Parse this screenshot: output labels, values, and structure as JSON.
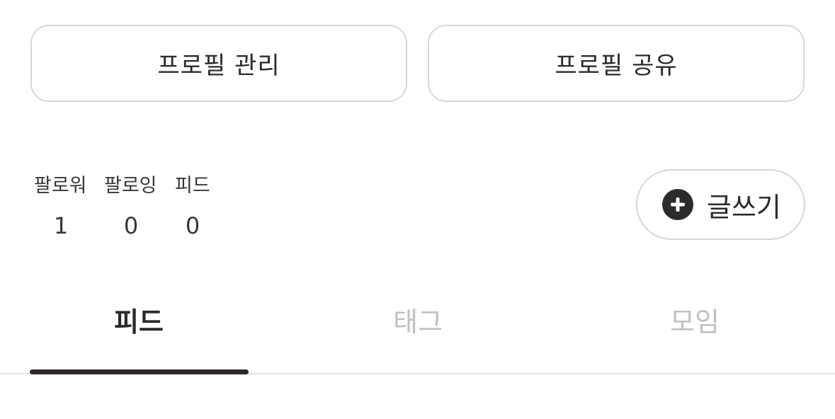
{
  "profile_actions": {
    "manage_label": "프로필 관리",
    "share_label": "프로필 공유"
  },
  "stats": [
    {
      "label": "팔로워",
      "value": "1"
    },
    {
      "label": "팔로잉",
      "value": "0"
    },
    {
      "label": "피드",
      "value": "0"
    }
  ],
  "write_button": {
    "icon": "plus-circle-icon",
    "label": "글쓰기"
  },
  "tabs": [
    {
      "label": "피드",
      "active": true
    },
    {
      "label": "태그",
      "active": false
    },
    {
      "label": "모임",
      "active": false
    }
  ],
  "colors": {
    "text_primary": "#2d2929",
    "text_inactive": "#c4bebe",
    "border": "#d9d6d6",
    "background": "#ffffff"
  }
}
